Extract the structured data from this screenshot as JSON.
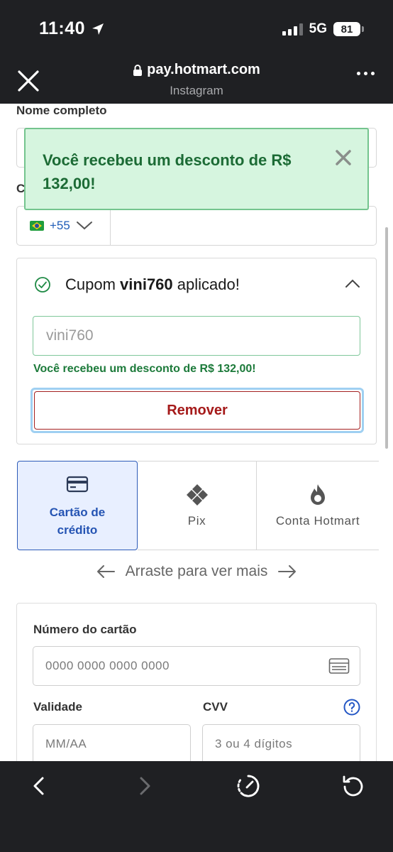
{
  "status_bar": {
    "time": "11:40",
    "network": "5G",
    "battery": "81"
  },
  "browser": {
    "url": "pay.hotmart.com",
    "subtitle": "Instagram"
  },
  "form": {
    "name_label": "Nome completo",
    "phone_label_partial": "C",
    "phone_ddi": "+55"
  },
  "toast": {
    "message": "Você recebeu um desconto de R$ 132,00!"
  },
  "coupon": {
    "prefix": "Cupom",
    "code": "vini760",
    "suffix": "aplicado!",
    "input_value": "vini760",
    "success_message": "Você recebeu um desconto de R$ 132,00!",
    "remove_label": "Remover"
  },
  "payment_methods": {
    "tabs": [
      {
        "line1": "Cartão de",
        "line2": "crédito",
        "selected": true
      },
      {
        "label": "Pix"
      },
      {
        "label": "Conta Hotmart"
      }
    ],
    "swipe_hint": "Arraste para ver mais"
  },
  "card_form": {
    "number_label": "Número do cartão",
    "number_placeholder": "0000 0000 0000 0000",
    "expiry_label": "Validade",
    "expiry_placeholder": "MM/AA",
    "cvv_label": "CVV",
    "cvv_placeholder": "3 ou 4 dígitos"
  },
  "colors": {
    "selected_tab_border": "#2d5bb8",
    "success_green": "#1c7a3a",
    "remove_red": "#a51a1a",
    "chrome_dark": "#1f2023"
  },
  "icons": {
    "close": "close-icon",
    "lock": "lock-icon",
    "more": "more-icon",
    "check_circle": "check-circle-icon",
    "chevron_up": "chevron-up-icon",
    "credit_card": "credit-card-icon",
    "pix": "pix-icon",
    "hotmart_flame": "flame-icon",
    "help": "help-icon",
    "back": "back-arrow-icon",
    "forward": "forward-arrow-icon",
    "speed": "speedometer-icon",
    "reload": "reload-icon"
  }
}
